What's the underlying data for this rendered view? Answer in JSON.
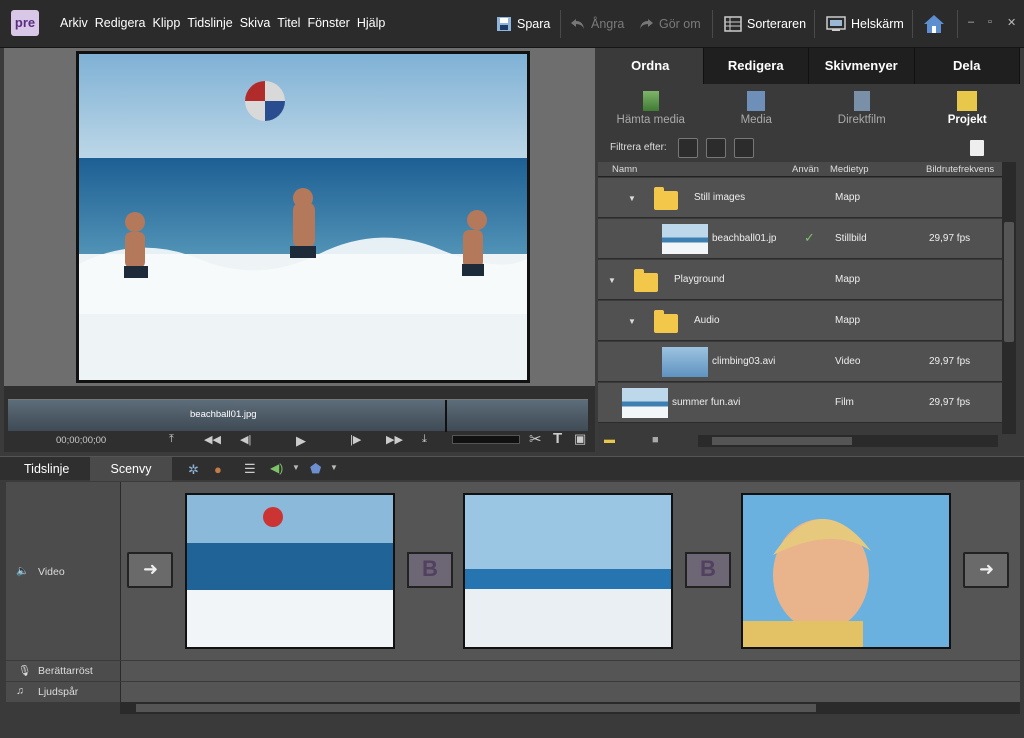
{
  "app": {
    "logo": "pre"
  },
  "menu": [
    "Arkiv",
    "Redigera",
    "Klipp",
    "Tidslinje",
    "Skiva",
    "Titel",
    "Fönster",
    "Hjälp"
  ],
  "toolbar": {
    "save": "Spara",
    "undo": "Ångra",
    "redo": "Gör om",
    "organizer": "Sorteraren",
    "fullscreen": "Helskärm"
  },
  "monitor": {
    "clip_name": "beachball01.jpg",
    "timecode": "00;00;00;00"
  },
  "panel": {
    "tabs": [
      "Ordna",
      "Redigera",
      "Skivmenyer",
      "Dela"
    ],
    "subtabs": [
      "Hämta media",
      "Media",
      "Direktfilm",
      "Projekt"
    ],
    "filter_label": "Filtrera efter:",
    "columns": [
      "Namn",
      "Använ",
      "Medietyp",
      "Bildrutefrekvens"
    ],
    "rows": [
      {
        "name": "Still images",
        "type": "Mapp",
        "fps": ""
      },
      {
        "name": "beachball01.jp",
        "type": "Stillbild",
        "fps": "29,97 fps"
      },
      {
        "name": "Playground",
        "type": "Mapp",
        "fps": ""
      },
      {
        "name": "Audio",
        "type": "Mapp",
        "fps": ""
      },
      {
        "name": "climbing03.avi",
        "type": "Video",
        "fps": "29,97 fps"
      },
      {
        "name": "summer fun.avi",
        "type": "Film",
        "fps": "29,97 fps"
      }
    ]
  },
  "timeline": {
    "tabs": [
      "Tidslinje",
      "Scenvy"
    ],
    "tracks": [
      "Video",
      "Berättarröst",
      "Ljudspår"
    ],
    "transition_label": "B"
  }
}
